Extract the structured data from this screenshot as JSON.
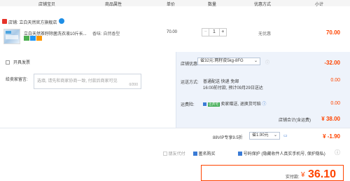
{
  "header": {
    "col1": "店铺宝贝",
    "col2": "商品属性",
    "col3": "单价",
    "col4": "数量",
    "col5": "优惠方式",
    "col6": "小计"
  },
  "store": {
    "label": "店铺: 立白天然官方旗舰店"
  },
  "item": {
    "title": "立白天然茶籽除菌洗衣液10斤长...",
    "attr": "香味: 自然香型",
    "price": "70.00",
    "qty": "1",
    "minus": "−",
    "plus": "+",
    "discount": "无优惠",
    "subtotal": "70.00"
  },
  "invoice": {
    "label": "开具发票"
  },
  "message": {
    "label": "给卖家留言:",
    "placeholder": "选填, 请先和商家协商一致, 付款后商家可见",
    "count": "0/200"
  },
  "store_discount": {
    "label": "店铺优惠:",
    "select": "省32元:两籽皮5kg-8FG",
    "amount": "-32.00"
  },
  "shipping": {
    "label": "运送方式:",
    "line1": "普通配送 快递 免邮",
    "line2": "16:00前付款, 预计09月29日送达",
    "amount": "0.00"
  },
  "return_ins": {
    "label": "运费险:",
    "badge": "运费险",
    "text": "卖家赠送, 退换货可赔",
    "amount": "0.00"
  },
  "store_total": {
    "label": "店铺合计(含运费)",
    "amount": "¥ 38.00"
  },
  "vip": {
    "label": "88VIP专享9.5折",
    "select": "省1.90元",
    "amount": "¥ -1.90"
  },
  "options": {
    "friend_pay": "朋友代付",
    "anonymous": "匿名购买",
    "privacy": "号码保护",
    "privacy_note": "(隐藏收件人真实手机号, 保护隐私)"
  },
  "pay": {
    "label": "实付款:",
    "currency": "¥",
    "amount": "36.10"
  },
  "colors": {
    "accent": "#ff4400",
    "panel": "#eef3fb",
    "blue": "#3a7bd5"
  }
}
